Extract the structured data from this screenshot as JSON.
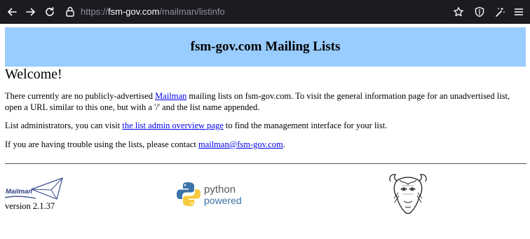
{
  "browser": {
    "url_scheme": "https://",
    "url_host": "fsm-gov.com",
    "url_path": "/mailman/listinfo"
  },
  "page": {
    "banner_title": "fsm-gov.com Mailing Lists",
    "welcome": "Welcome!",
    "para1_before": "There currently are no publicly-advertised ",
    "para1_link": "Mailman",
    "para1_after": " mailing lists on fsm-gov.com. To visit the general information page for an unadvertised list, open a URL similar to this one, but with a '/' and the list name appended.",
    "para2_before": "List administrators, you can visit ",
    "para2_link": "the list admin overview page",
    "para2_after": " to find the management interface for your list.",
    "para3_before": "If you are having trouble using the lists, please contact ",
    "para3_link": "mailman@fsm-gov.com",
    "para3_after": "."
  },
  "footer": {
    "mailman_logo_text": "Mailman",
    "version": "version 2.1.37",
    "python_word": "python",
    "powered_word": "powered"
  },
  "icons": {
    "back": "back-arrow-icon",
    "forward": "forward-arrow-icon",
    "reload": "reload-icon",
    "lock": "lock-icon",
    "bookmark": "star-icon",
    "shield": "shield-icon",
    "extensions": "sparkle-wand-icon",
    "menu": "hamburger-menu-icon"
  },
  "colors": {
    "toolbar_bg": "#1c1b22",
    "banner_bg": "#99ccff",
    "link": "#0000ee"
  }
}
